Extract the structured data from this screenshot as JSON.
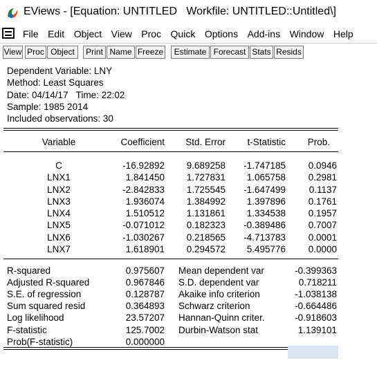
{
  "window": {
    "title": "EViews - [Equation: UNTITLED   Workfile: UNTITLED::Untitled\\]",
    "icon": "eviews-logo-icon"
  },
  "menu": [
    "File",
    "Edit",
    "Object",
    "View",
    "Proc",
    "Quick",
    "Options",
    "Add-ins",
    "Window",
    "Help"
  ],
  "toolbar": [
    "View",
    "Proc",
    "Object",
    "Print",
    "Name",
    "Freeze",
    "Estimate",
    "Forecast",
    "Stats",
    "Resids"
  ],
  "header": [
    "Dependent Variable: LNY",
    "Method: Least Squares",
    "Date: 04/14/17   Time: 22:02",
    "Sample: 1985 2014",
    "Included observations: 30"
  ],
  "coef_table": {
    "columns": [
      "Variable",
      "Coefficient",
      "Std. Error",
      "t-Statistic",
      "Prob."
    ],
    "rows": [
      [
        "C",
        "-16.92892",
        "9.689258",
        "-1.747185",
        "0.0946"
      ],
      [
        "LNX1",
        "1.841450",
        "1.727831",
        "1.065758",
        "0.2981"
      ],
      [
        "LNX2",
        "-2.842833",
        "1.725545",
        "-1.647499",
        "0.1137"
      ],
      [
        "LNX3",
        "1.936074",
        "1.384992",
        "1.397896",
        "0.1761"
      ],
      [
        "LNX4",
        "1.510512",
        "1.131861",
        "1.334538",
        "0.1957"
      ],
      [
        "LNX5",
        "-0.071012",
        "0.182323",
        "-0.389486",
        "0.7007"
      ],
      [
        "LNX6",
        "-1.030267",
        "0.218565",
        "-4.713783",
        "0.0001"
      ],
      [
        "LNX7",
        "1.618901",
        "0.294572",
        "5.495776",
        "0.0000"
      ]
    ]
  },
  "stats_table": [
    [
      "R-squared",
      "0.975607",
      "Mean dependent var",
      "-0.399363"
    ],
    [
      "Adjusted R-squared",
      "0.967846",
      "S.D. dependent var",
      "0.718211"
    ],
    [
      "S.E. of regression",
      "0.128787",
      "Akaike info criterion",
      "-1.038138"
    ],
    [
      "Sum squared resid",
      "0.364893",
      "Schwarz criterion",
      "-0.664486"
    ],
    [
      "Log likelihood",
      "23.57207",
      "Hannan-Quinn criter.",
      "-0.918603"
    ],
    [
      "F-statistic",
      "125.7002",
      "Durbin-Watson stat",
      "1.139101"
    ],
    [
      "Prob(F-statistic)",
      "0.000000",
      "",
      ""
    ]
  ]
}
